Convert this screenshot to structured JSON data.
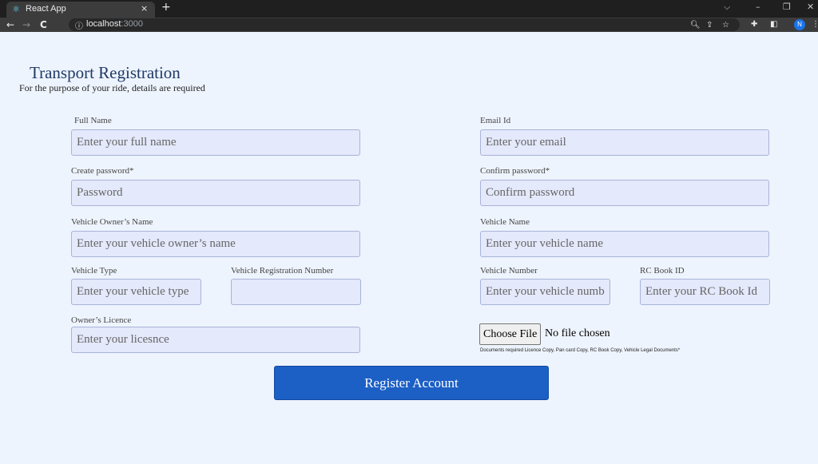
{
  "browser": {
    "tab_title": "React App",
    "tab_close": "×",
    "new_tab": "+",
    "url_host": "localhost",
    "url_port": ":3000",
    "profile_initial": "N",
    "window_controls": [
      "⌵",
      "–",
      "❐",
      "✕"
    ],
    "nav_icons": [
      "back-icon",
      "forward-icon",
      "reload-icon"
    ],
    "toolbar_icons": [
      "zoom-icon",
      "share-icon",
      "star-icon",
      "extensions-icon",
      "sidepanel-icon",
      "menu-icon"
    ]
  },
  "page": {
    "title": "Transport Registration",
    "subtitle": "For the purpose of your ride, details are required"
  },
  "form": {
    "full_name": {
      "label": "Full Name",
      "placeholder": "Enter your full name"
    },
    "email": {
      "label": "Email Id",
      "placeholder": "Enter your email"
    },
    "create_password": {
      "label": "Create password*",
      "placeholder": "Password"
    },
    "confirm_password": {
      "label": "Confirm password*",
      "placeholder": "Confirm password"
    },
    "owner_name": {
      "label": "Vehicle Owner’s Name",
      "placeholder": "Enter your vehicle owner’s name"
    },
    "vehicle_name": {
      "label": "Vehicle Name",
      "placeholder": "Enter your vehicle name"
    },
    "vehicle_type": {
      "label": "Vehicle Type",
      "placeholder": "Enter your vehicle type"
    },
    "registration_number": {
      "label": "Vehicle Registration Number",
      "placeholder": ""
    },
    "vehicle_number": {
      "label": "Vehicle Number",
      "placeholder": "Enter your vehicle number"
    },
    "rc_book": {
      "label": "RC Book ID",
      "placeholder": "Enter your RC Book Id"
    },
    "licence": {
      "label": "Owner’s Licence",
      "placeholder": "Enter your licesnce"
    },
    "file": {
      "button": "Choose File",
      "status": "No file chosen",
      "note": "Documents required Licence Copy, Pan card Copy, RC Book Copy, Vehicle Legal Documents*"
    },
    "submit": "Register Account"
  }
}
